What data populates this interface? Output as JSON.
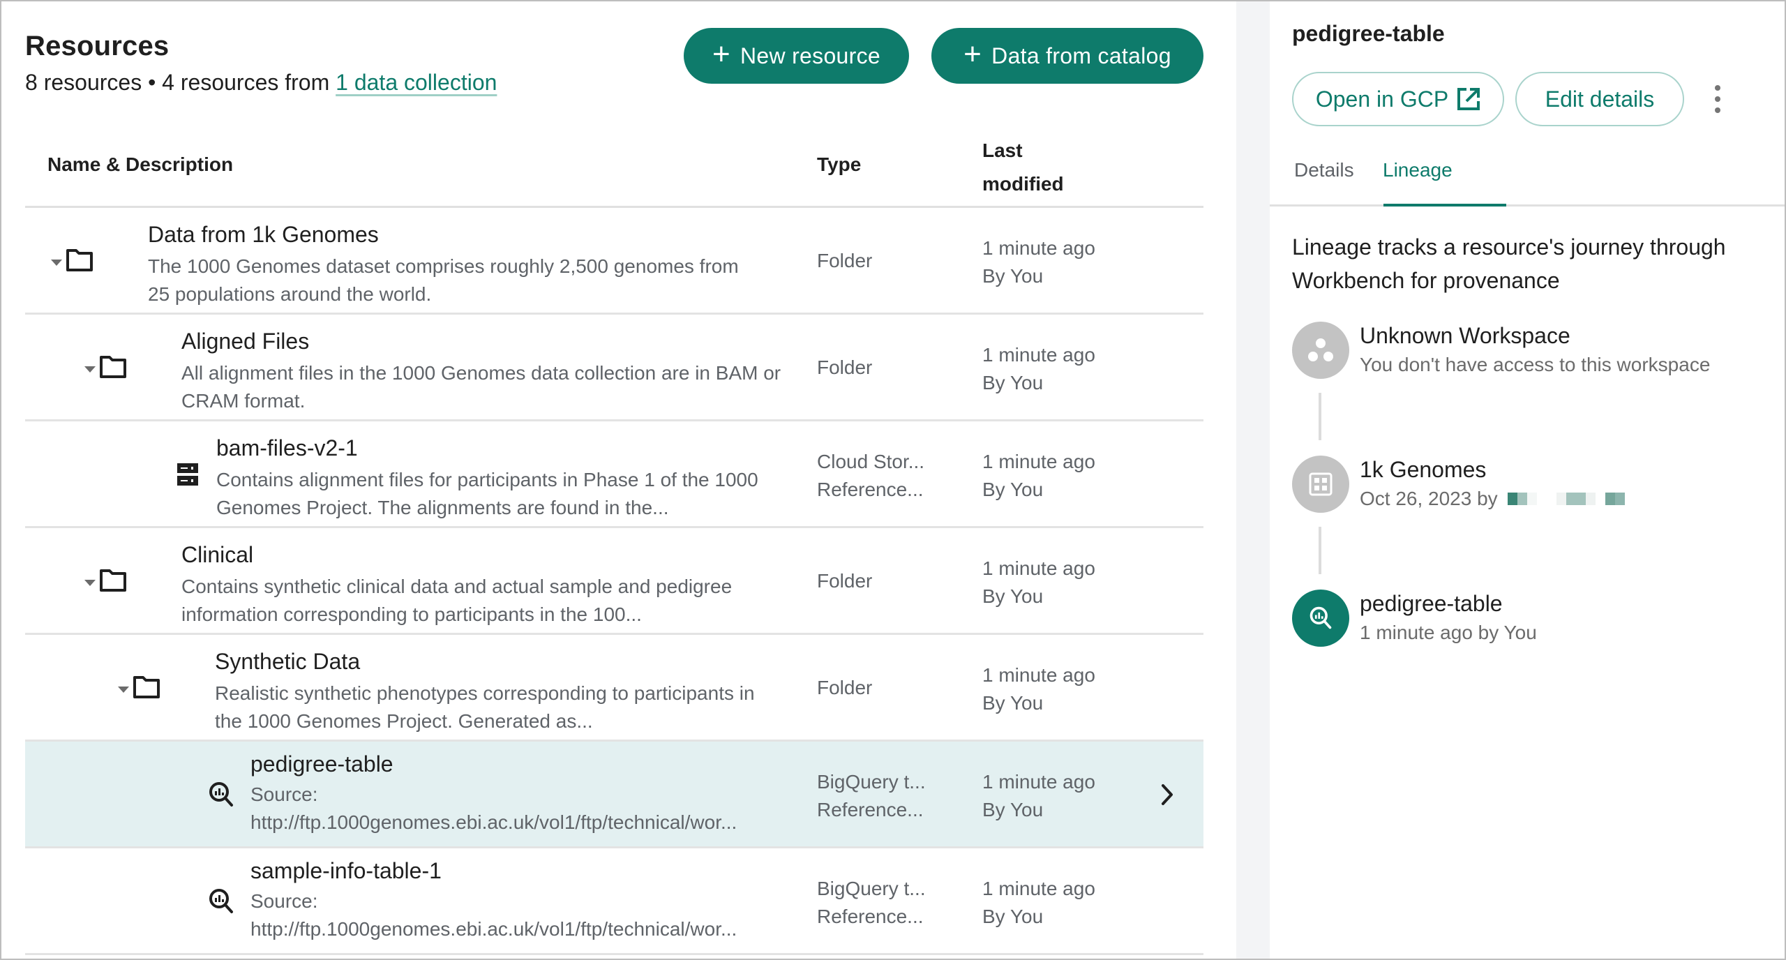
{
  "main": {
    "title": "Resources",
    "subtitle_prefix": "8 resources • 4 resources from ",
    "subtitle_link": "1 data collection",
    "buttons": {
      "new_resource": "New resource",
      "data_from_catalog": "Data from catalog"
    },
    "table": {
      "columns": [
        "Name & Description",
        "Type",
        "Last modified"
      ],
      "rows": [
        {
          "name": "Data from 1k Genomes",
          "description": "The 1000 Genomes dataset comprises roughly 2,500 genomes from 25 populations around the world.",
          "icon": "folder-icon",
          "expanded": true,
          "type_line1": "Folder",
          "type_line2": "",
          "modified_line1": "1 minute ago",
          "modified_line2": "By You",
          "selected": false
        },
        {
          "name": "Aligned Files",
          "description": "All alignment files in the 1000 Genomes data collection are in BAM or CRAM format.",
          "icon": "folder-icon",
          "expanded": true,
          "type_line1": "Folder",
          "type_line2": "",
          "modified_line1": "1 minute ago",
          "modified_line2": "By You",
          "selected": false
        },
        {
          "name": "bam-files-v2-1",
          "description": "Contains alignment files for participants in Phase 1 of the 1000 Genomes Project. The alignments are found in the...",
          "icon": "cloud-storage-icon",
          "expanded": false,
          "type_line1": "Cloud Stor...",
          "type_line2": "Reference...",
          "modified_line1": "1 minute ago",
          "modified_line2": "By You",
          "selected": false
        },
        {
          "name": "Clinical",
          "description": "Contains synthetic clinical data and actual sample and pedigree information corresponding to participants in the 100...",
          "icon": "folder-icon",
          "expanded": true,
          "type_line1": "Folder",
          "type_line2": "",
          "modified_line1": "1 minute ago",
          "modified_line2": "By You",
          "selected": false
        },
        {
          "name": "Synthetic Data",
          "description": "Realistic synthetic phenotypes corresponding to participants in the 1000 Genomes Project. Generated as...",
          "icon": "folder-icon",
          "expanded": true,
          "type_line1": "Folder",
          "type_line2": "",
          "modified_line1": "1 minute ago",
          "modified_line2": "By You",
          "selected": false
        },
        {
          "name": "pedigree-table",
          "description_line1": "Source:",
          "description_line2": "http://ftp.1000genomes.ebi.ac.uk/vol1/ftp/technical/wor...",
          "icon": "bigquery-table-icon",
          "expanded": false,
          "type_line1": "BigQuery t...",
          "type_line2": "Reference...",
          "modified_line1": "1 minute ago",
          "modified_line2": "By You",
          "selected": true
        },
        {
          "name": "sample-info-table-1",
          "description_line1": "Source:",
          "description_line2": "http://ftp.1000genomes.ebi.ac.uk/vol1/ftp/technical/wor...",
          "icon": "bigquery-table-icon",
          "expanded": false,
          "type_line1": "BigQuery t...",
          "type_line2": "Reference...",
          "modified_line1": "1 minute ago",
          "modified_line2": "By You",
          "selected": false
        }
      ]
    }
  },
  "panel": {
    "title": "pedigree-table",
    "buttons": {
      "open_in_gcp": "Open in GCP",
      "edit_details": "Edit details"
    },
    "tabs": [
      {
        "label": "Details",
        "active": false
      },
      {
        "label": "Lineage",
        "active": true
      }
    ],
    "lineage": {
      "intro": "Lineage tracks a resource's journey through Workbench for provenance",
      "items": [
        {
          "title": "Unknown Workspace",
          "subtitle": "You don't have access to this workspace",
          "icon": "workspace-icon",
          "active": false
        },
        {
          "title": "1k Genomes",
          "subtitle": "Oct 26, 2023 by",
          "icon": "data-collection-icon",
          "active": false,
          "author_redacted": true
        },
        {
          "title": "pedigree-table",
          "subtitle": "1 minute ago by You",
          "icon": "bigquery-table-icon",
          "active": true
        }
      ]
    }
  },
  "colors": {
    "accent": "#0e7b6b",
    "selected_row": "#e3f0f1",
    "gutter": "#f3f4f6",
    "muted_text": "#5f6368",
    "inactive_node": "#c3c3c3"
  }
}
